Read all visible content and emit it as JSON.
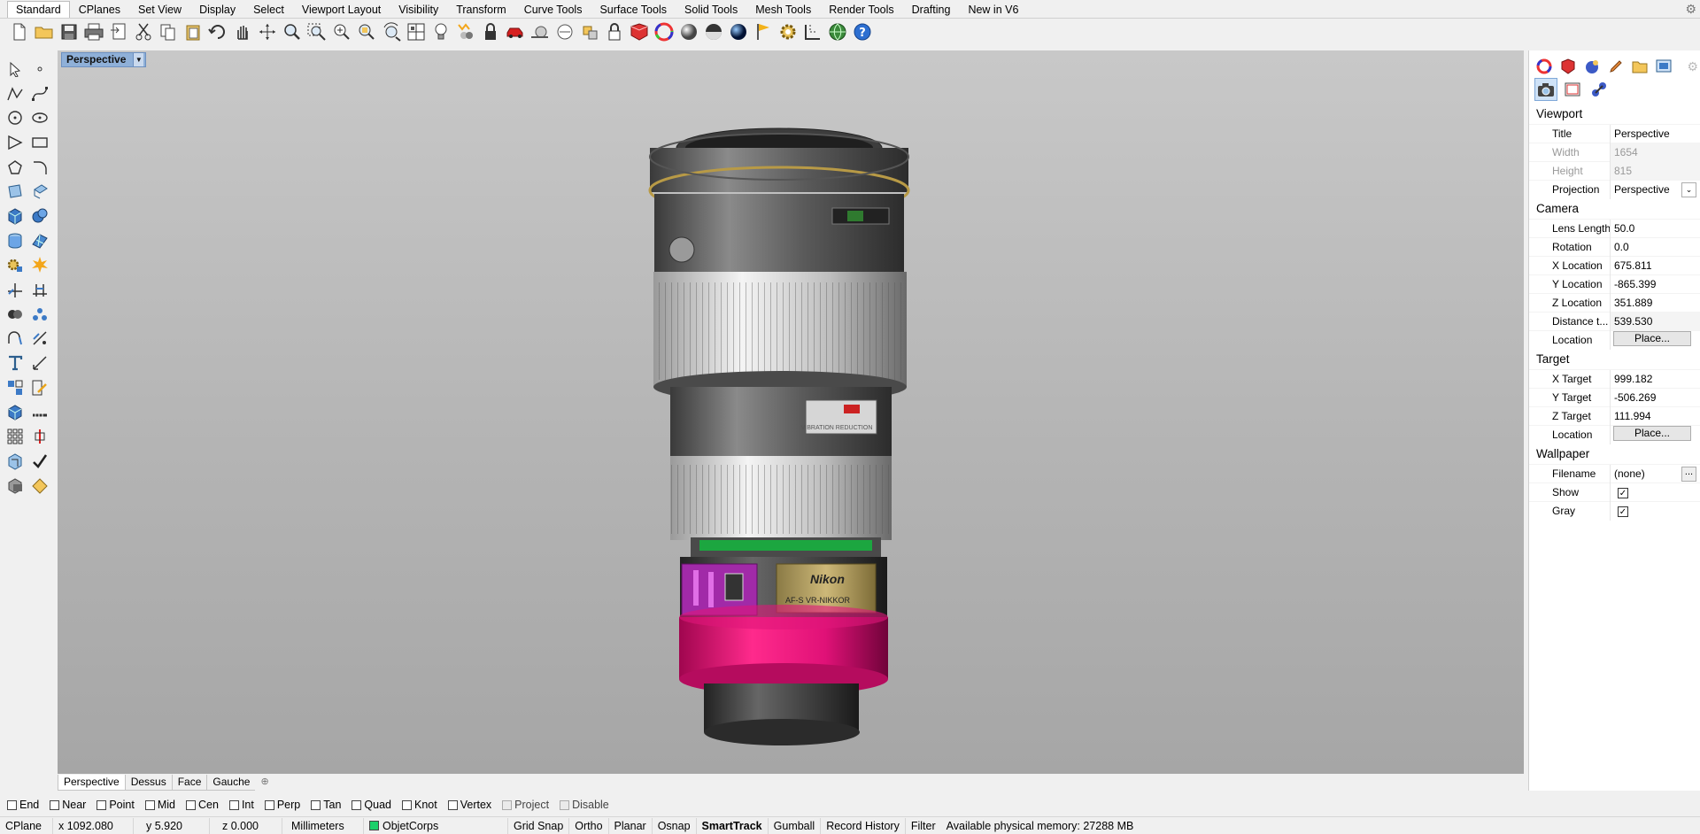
{
  "tabs": [
    "Standard",
    "CPlanes",
    "Set View",
    "Display",
    "Select",
    "Viewport Layout",
    "Visibility",
    "Transform",
    "Curve Tools",
    "Surface Tools",
    "Solid Tools",
    "Mesh Tools",
    "Render Tools",
    "Drafting",
    "New in V6"
  ],
  "toolbar_icons": [
    "new-file",
    "open",
    "save",
    "print",
    "import",
    "cut",
    "copy",
    "paste",
    "undo",
    "pan",
    "rotate-view",
    "zoom",
    "zoom-window",
    "zoom-extents",
    "zoom-selected",
    "rotate-camera",
    "four-viewports",
    "light-bulb",
    "filter",
    "lock",
    "car",
    "snail",
    "match",
    "explode",
    "object-lock",
    "shade-material",
    "color-wheel",
    "render-sphere",
    "material-ball",
    "env-map",
    "properties-flag",
    "gear-options",
    "dimension",
    "globe",
    "help"
  ],
  "viewport": {
    "title": "Perspective",
    "bg_top": "#c8c8c8",
    "bg_bottom": "#a6a6a6"
  },
  "viewport_tabs": [
    "Perspective",
    "Dessus",
    "Face",
    "Gauche"
  ],
  "osnaps": [
    {
      "label": "End",
      "checked": false,
      "disabled": false
    },
    {
      "label": "Near",
      "checked": false,
      "disabled": false
    },
    {
      "label": "Point",
      "checked": false,
      "disabled": false
    },
    {
      "label": "Mid",
      "checked": false,
      "disabled": false
    },
    {
      "label": "Cen",
      "checked": false,
      "disabled": false
    },
    {
      "label": "Int",
      "checked": false,
      "disabled": false
    },
    {
      "label": "Perp",
      "checked": false,
      "disabled": false
    },
    {
      "label": "Tan",
      "checked": false,
      "disabled": false
    },
    {
      "label": "Quad",
      "checked": false,
      "disabled": false
    },
    {
      "label": "Knot",
      "checked": false,
      "disabled": false
    },
    {
      "label": "Vertex",
      "checked": false,
      "disabled": false
    },
    {
      "label": "Project",
      "checked": false,
      "disabled": true
    },
    {
      "label": "Disable",
      "checked": false,
      "disabled": true
    }
  ],
  "status": {
    "cplane": "CPlane",
    "x": "x 1092.080",
    "y": "y 5.920",
    "z": "z 0.000",
    "units": "Millimeters",
    "layer": "ObjetCorps",
    "layer_color": "#1bd06a",
    "toggles": [
      "Grid Snap",
      "Ortho",
      "Planar",
      "Osnap",
      "SmartTrack",
      "Gumball",
      "Record History",
      "Filter"
    ],
    "active_toggle": "SmartTrack",
    "memory": "Available physical memory: 27288 MB"
  },
  "panel": {
    "viewport_title": "Viewport",
    "title_label": "Title",
    "title_value": "Perspective",
    "width_label": "Width",
    "width_value": "1654",
    "height_label": "Height",
    "height_value": "815",
    "projection_label": "Projection",
    "projection_value": "Perspective",
    "camera_title": "Camera",
    "lens_label": "Lens Length",
    "lens_value": "50.0",
    "rotation_label": "Rotation",
    "rotation_value": "0.0",
    "xloc_label": "X Location",
    "xloc_value": "675.811",
    "yloc_label": "Y Location",
    "yloc_value": "-865.399",
    "zloc_label": "Z Location",
    "zloc_value": "351.889",
    "dist_label": "Distance t...",
    "dist_value": "539.530",
    "location_label": "Location",
    "place_label": "Place...",
    "target_title": "Target",
    "xt_label": "X Target",
    "xt_value": "999.182",
    "yt_label": "Y Target",
    "yt_value": "-506.269",
    "zt_label": "Z Target",
    "zt_value": "111.994",
    "wallpaper_title": "Wallpaper",
    "filename_label": "Filename",
    "filename_value": "(none)",
    "show_label": "Show",
    "show_checked": true,
    "gray_label": "Gray",
    "gray_checked": true,
    "dots": "..."
  },
  "model_labels": {
    "brand": "Nikon",
    "line1": "AF-S VR-NIKKOR",
    "vr": "VIBRATION REDUCTION"
  }
}
